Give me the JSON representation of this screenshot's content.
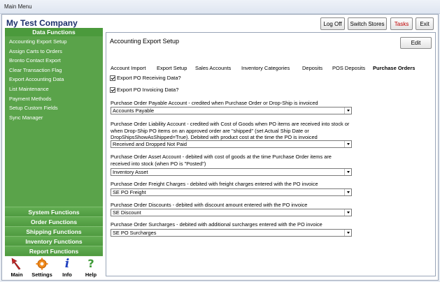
{
  "window": {
    "title": "Main Menu"
  },
  "company": {
    "name": "My Test Company"
  },
  "top_buttons": {
    "logoff": "Log Off",
    "switch_stores": "Switch Stores",
    "tasks": "Tasks",
    "exit": "Exit"
  },
  "sidebar": {
    "header": "Data Functions",
    "items": [
      "Accounting Export Setup",
      "Assign Carts to Orders",
      "Bronto Contact Export",
      "Clear Transaction Flag",
      "Export Accounting Data",
      "List Maintenance",
      "Payment Methods",
      "Setup Custom Fields",
      "Sync Manager"
    ],
    "functions": [
      "System Functions",
      "Order Functions",
      "Shipping Functions",
      "Inventory Functions",
      "Report Functions"
    ]
  },
  "iconbar": {
    "main": "Main",
    "settings": "Settings",
    "info": "Info",
    "help": "Help"
  },
  "panel": {
    "title": "Accounting Export Setup",
    "edit_label": "Edit",
    "tabs": [
      "Account Import",
      "Export Setup",
      "Sales Accounts",
      "Inventory Categories",
      "Deposits",
      "POS Deposits",
      "Purchase Orders"
    ],
    "checkboxes": [
      "Export PO Receiving Data?",
      "Export PO Invoicing Data?"
    ],
    "fields": [
      {
        "label": "Purchase Order Payable Account - credited when Purchase Order or Drop-Ship is invoiced",
        "value": "Accounts Payable"
      },
      {
        "label": "Purchase Order Liability Account - credited with Cost of Goods when PO items are received into stock or when Drop-Ship PO items on an approved order are \"shipped\" (set Actual Ship Date or DropShipsShowAsShipped=True). Debited with product cost at the time the PO is invoiced",
        "value": "Received and Dropped Not Paid"
      },
      {
        "label": "Purchase Order Asset Account - debited with cost of goods at the time Purchase Order items are received into stock (when PO is \"Posted\")",
        "value": "Inventory Asset"
      },
      {
        "label": "Purchase Order Freight Charges - debited with freight charges entered with the PO invoice",
        "value": "SE PO Freight"
      },
      {
        "label": "Purchase Order Discounts - debited with discount amount entered with the PO invoice",
        "value": "SE Discount"
      },
      {
        "label": "Purchase Order Surcharges - debited with additional surcharges entered with the PO invoice",
        "value": "SE PO Surcharges"
      }
    ]
  }
}
